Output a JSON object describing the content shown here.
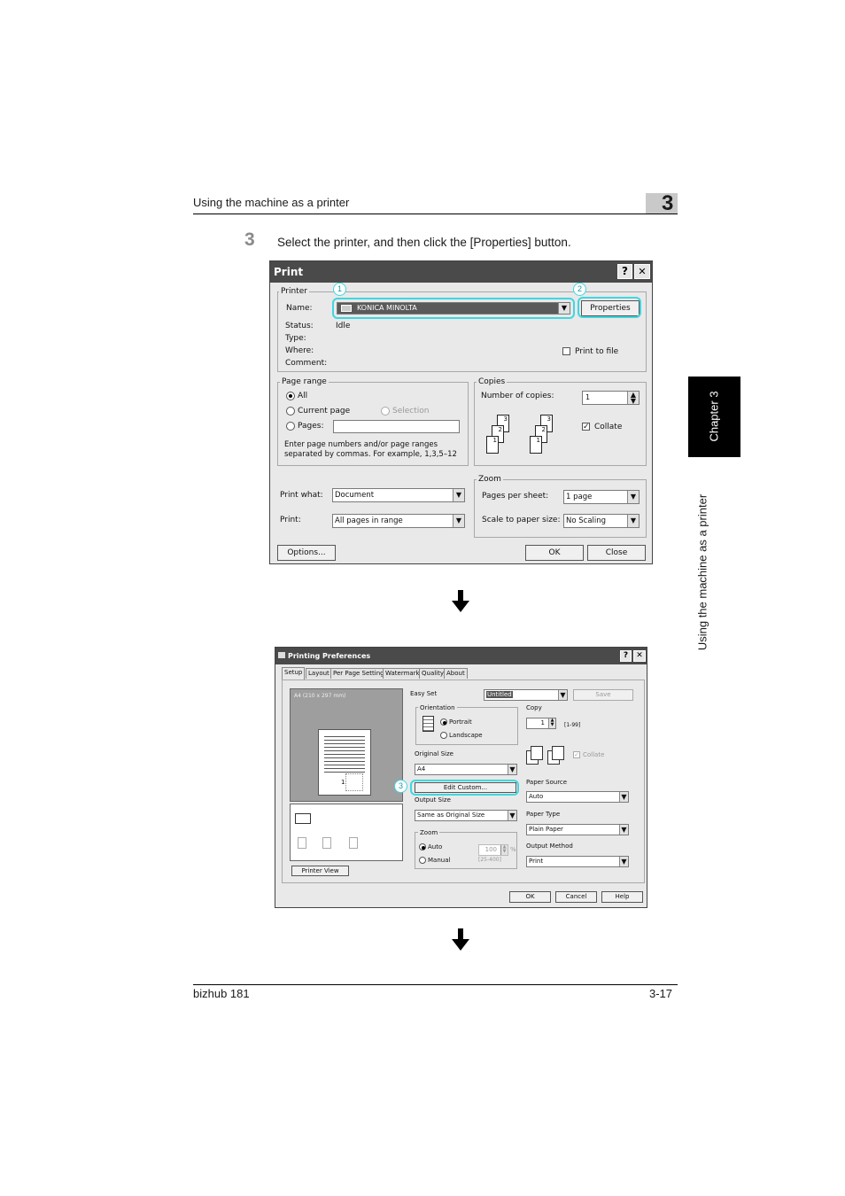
{
  "header": {
    "section_title": "Using the machine as a printer",
    "chapter_number": "3"
  },
  "side_tab": {
    "chapter_label": "Chapter 3",
    "section_title": "Using the machine as a printer"
  },
  "step": {
    "number": "3",
    "text": "Select the printer, and then click the [Properties] button."
  },
  "print_dialog": {
    "title": "Print",
    "help_btn": "?",
    "close_btn": "✕",
    "printer_group": "Printer",
    "name_label": "Name:",
    "name_value": "KONICA MINOLTA",
    "properties_btn": "Properties",
    "status_label": "Status:",
    "status_value": "Idle",
    "type_label": "Type:",
    "where_label": "Where:",
    "comment_label": "Comment:",
    "print_to_file": "Print to file",
    "page_range_group": "Page range",
    "all": "All",
    "current_page": "Current page",
    "selection": "Selection",
    "pages": "Pages:",
    "range_hint_1": "Enter page numbers and/or page ranges",
    "range_hint_2": "separated by commas.  For example, 1,3,5–12",
    "copies_group": "Copies",
    "num_copies_label": "Number of copies:",
    "num_copies_value": "1",
    "collate": "Collate",
    "print_what_label": "Print what:",
    "print_what_value": "Document",
    "print_label": "Print:",
    "print_value": "All pages in range",
    "zoom_group": "Zoom",
    "pages_per_sheet_label": "Pages per sheet:",
    "pages_per_sheet_value": "1 page",
    "scale_label": "Scale to paper size:",
    "scale_value": "No Scaling",
    "options_btn": "Options...",
    "ok_btn": "OK",
    "close_btn_label": "Close",
    "callouts": [
      "1",
      "2"
    ]
  },
  "prefs_dialog": {
    "title": "Printing Preferences",
    "help_btn": "?",
    "close_btn": "✕",
    "tabs": [
      "Setup",
      "Layout",
      "Per Page Setting",
      "Watermark",
      "Quality",
      "About"
    ],
    "preview_caption": "A4  (210 x 297 mm)",
    "preview_page_num": "1",
    "printer_view_btn": "Printer View",
    "easy_set_label": "Easy Set",
    "easy_set_value": "Untitled",
    "save_btn": "Save",
    "orientation_group": "Orientation",
    "portrait": "Portrait",
    "landscape": "Landscape",
    "copy_label": "Copy",
    "copy_value": "1",
    "copy_range": "[1-99]",
    "collate": "Collate",
    "original_size_label": "Original Size",
    "original_size_value": "A4",
    "edit_custom_btn": "Edit Custom...",
    "paper_source_label": "Paper Source",
    "paper_source_value": "Auto",
    "output_size_label": "Output Size",
    "output_size_value": "Same as Original Size",
    "paper_type_label": "Paper Type",
    "paper_type_value": "Plain Paper",
    "zoom_group": "Zoom",
    "zoom_auto": "Auto",
    "zoom_manual": "Manual",
    "zoom_value": "100",
    "zoom_range": "[25-400]",
    "zoom_unit": "%",
    "output_method_label": "Output Method",
    "output_method_value": "Print",
    "ok_btn": "OK",
    "cancel_btn": "Cancel",
    "help_button_label": "Help",
    "callout": "3"
  },
  "footer": {
    "model": "bizhub 181",
    "page": "3-17"
  },
  "colors": {
    "highlight": "#3fd7e0",
    "title_bar": "#4a4a4a",
    "side_tab": "#000000"
  }
}
